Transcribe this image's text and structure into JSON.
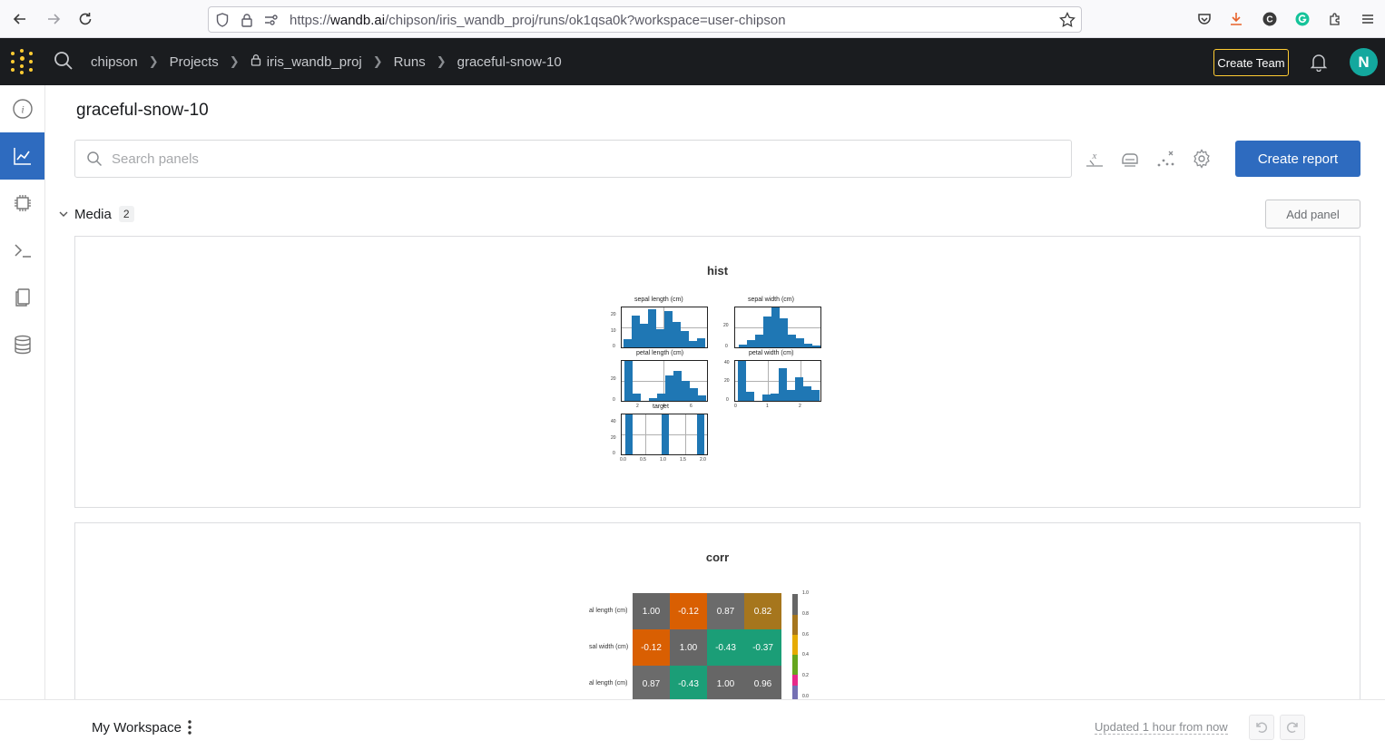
{
  "browser": {
    "url_prefix": "https://",
    "url_domain": "wandb.ai",
    "url_path": "/chipson/iris_wandb_proj/runs/ok1qsa0k?workspace=user-chipson"
  },
  "header": {
    "breadcrumbs": [
      "chipson",
      "Projects",
      "iris_wandb_proj",
      "Runs",
      "graceful-snow-10"
    ],
    "create_team_label": "Create Team",
    "avatar_initial": "N",
    "accent_color": "#ffcc33"
  },
  "main": {
    "run_title": "graceful-snow-10",
    "search_placeholder": "Search panels",
    "create_report_label": "Create report",
    "section": {
      "name": "Media",
      "count": "2",
      "add_panel_label": "Add panel"
    },
    "panels": [
      {
        "title": "hist",
        "subplots": [
          {
            "title": "sepal length (cm)",
            "yticks": [
              "20",
              "10",
              "0"
            ]
          },
          {
            "title": "sepal width (cm)",
            "yticks": [
              "20",
              "0"
            ]
          },
          {
            "title": "petal length (cm)",
            "yticks": [
              "20",
              "0"
            ],
            "xticks": [
              "2",
              "4",
              "6"
            ]
          },
          {
            "title": "petal width (cm)",
            "yticks": [
              "40",
              "20",
              "0"
            ],
            "xticks": [
              "0",
              "1",
              "2"
            ]
          },
          {
            "title": "target",
            "yticks": [
              "40",
              "20",
              "0"
            ],
            "xticks": [
              "0.0",
              "0.5",
              "1.0",
              "1.5",
              "2.0"
            ]
          }
        ]
      },
      {
        "title": "corr",
        "row_labels": [
          "al length (cm)",
          "sal width (cm)",
          "al length (cm)"
        ],
        "values": [
          [
            "1.00",
            "-0.12",
            "0.87",
            "0.82"
          ],
          [
            "-0.12",
            "1.00",
            "-0.43",
            "-0.37"
          ],
          [
            "0.87",
            "-0.43",
            "1.00",
            "0.96"
          ]
        ],
        "colorbar_ticks": [
          "1.0",
          "0.8",
          "0.6",
          "0.4",
          "0.2",
          "0.0"
        ]
      }
    ]
  },
  "footer": {
    "workspace_name": "My Workspace",
    "updated_text": "Updated 1 hour from now"
  }
}
